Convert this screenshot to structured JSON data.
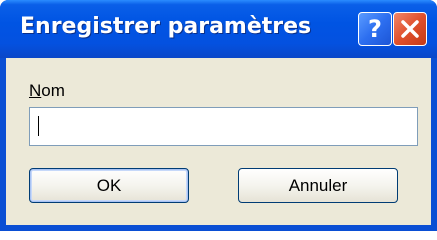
{
  "dialog": {
    "title": "Enregistrer paramètres",
    "help_glyph": "?",
    "close_icon": "close-icon",
    "help_icon": "help-icon"
  },
  "form": {
    "name_label_accel": "N",
    "name_label_rest": "om",
    "name_value": "",
    "name_placeholder": ""
  },
  "buttons": {
    "ok_label": "OK",
    "cancel_label": "Annuler"
  },
  "colors": {
    "titlebar": "#0054e3",
    "close_button": "#e0502c",
    "client_background": "#ece9d8"
  }
}
